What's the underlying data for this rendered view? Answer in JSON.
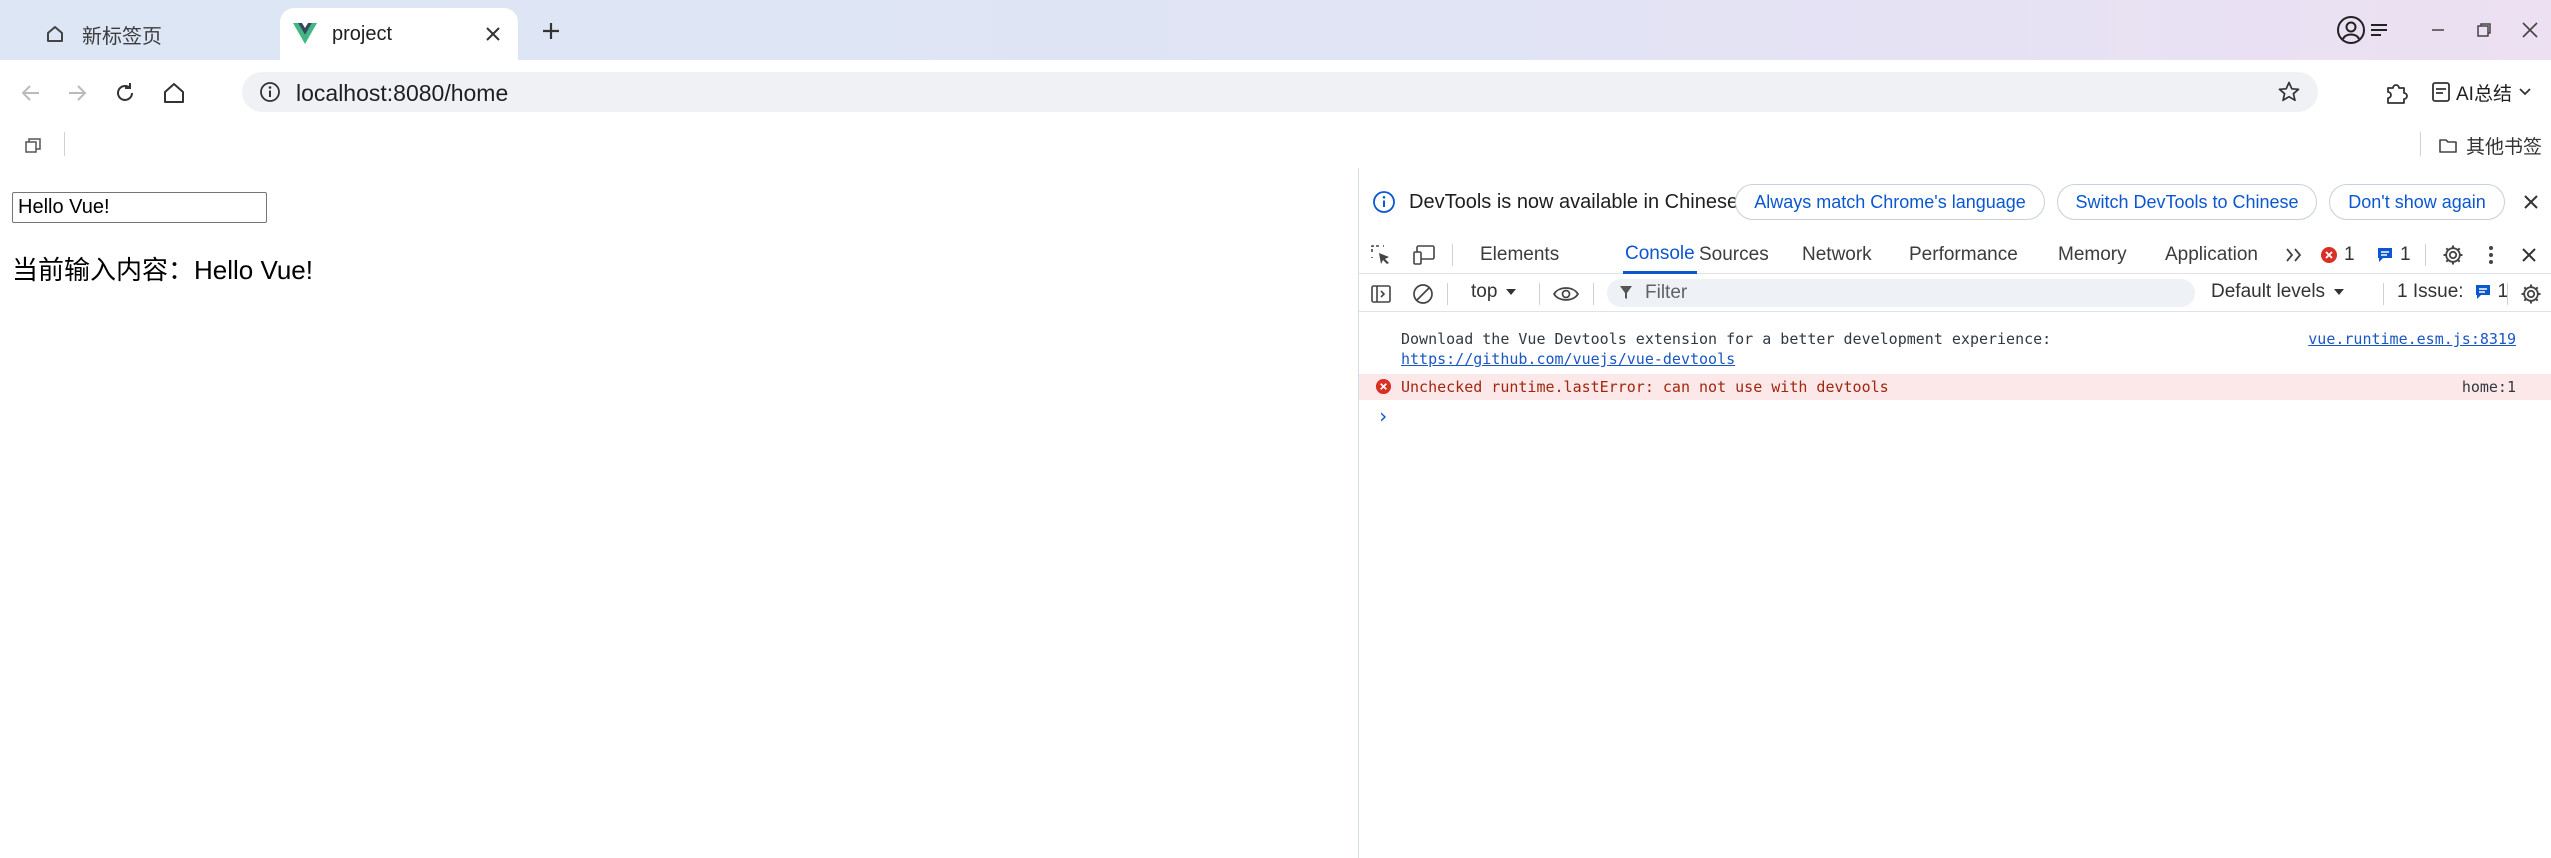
{
  "tabs": [
    {
      "title": "新标签页",
      "icon": "home-icon",
      "active": false
    },
    {
      "title": "project",
      "icon": "vue-logo-icon",
      "active": true
    }
  ],
  "toolbar": {
    "url": "localhost:8080/home",
    "ai_label": "AI总结"
  },
  "bookmarks": {
    "other_label": "其他书签"
  },
  "page": {
    "input_value": "Hello Vue!",
    "echo_text": "当前输入内容：Hello Vue!"
  },
  "devtools": {
    "infobar": {
      "message": "DevTools is now available in Chinese!",
      "btn_match": "Always match Chrome's language",
      "btn_switch": "Switch DevTools to Chinese",
      "btn_dismiss": "Don't show again"
    },
    "tabs": [
      "Elements",
      "Console",
      "Sources",
      "Network",
      "Performance",
      "Memory",
      "Application"
    ],
    "active_tab": "Console",
    "error_count": "1",
    "message_count": "1",
    "context": "top",
    "filter_placeholder": "Filter",
    "levels": "Default levels",
    "issues_label": "1 Issue:",
    "issues_count": "1",
    "messages": [
      {
        "text": "Download the Vue Devtools extension for a better development experience:",
        "link": "https://github.com/vuejs/vue-devtools",
        "source": "vue.runtime.esm.js:8319",
        "level": "info"
      },
      {
        "text": "Unchecked runtime.lastError: can not use with devtools",
        "source": "home:1",
        "level": "error"
      }
    ],
    "prompt": "›"
  },
  "colors": {
    "accent": "#0b57d0",
    "error_bg": "#fce8e8",
    "error_icon": "#d93025",
    "vue_green": "#41b883",
    "vue_dark": "#35495e"
  }
}
